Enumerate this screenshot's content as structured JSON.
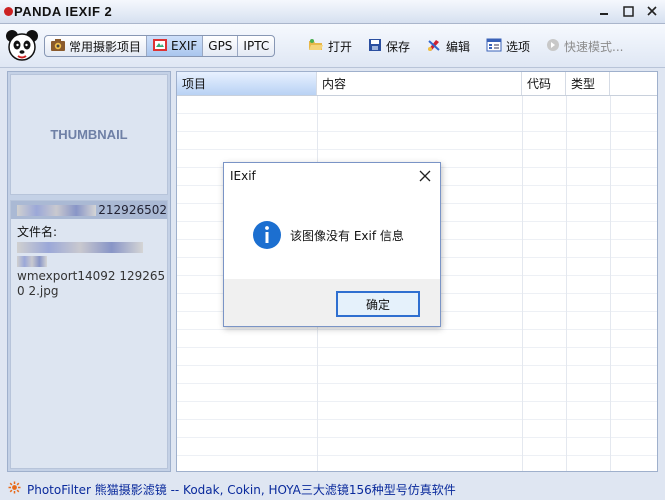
{
  "window": {
    "title": "PANDA IEXIF 2"
  },
  "tabs": [
    {
      "label": "常用摄影项目",
      "icon": "camera-icon"
    },
    {
      "label": "EXIF",
      "icon": "exif-icon"
    },
    {
      "label": "GPS"
    },
    {
      "label": "IPTC"
    }
  ],
  "toolbar": {
    "open_label": "打开",
    "save_label": "保存",
    "edit_label": "编辑",
    "options_label": "选项",
    "quick_mode_label": "快速模式..."
  },
  "left_panel": {
    "thumbnail_label": "THUMBNAIL",
    "file_id_suffix": "212926502",
    "filename_label": "文件名:",
    "filename_text": "wmexport14092 1292650 2.jpg"
  },
  "grid": {
    "columns": [
      "项目",
      "内容",
      "代码",
      "类型"
    ]
  },
  "dialog": {
    "title": "IExif",
    "message": "该图像没有 Exif 信息",
    "ok_label": "确定"
  },
  "status": {
    "text": "PhotoFilter 熊猫摄影滤镜 -- Kodak, Cokin, HOYA三大滤镜156种型号仿真软件"
  },
  "colors": {
    "accent": "#2f6fd0",
    "status_text": "#0a2a9c",
    "panel_bg": "#c4d1e6"
  }
}
